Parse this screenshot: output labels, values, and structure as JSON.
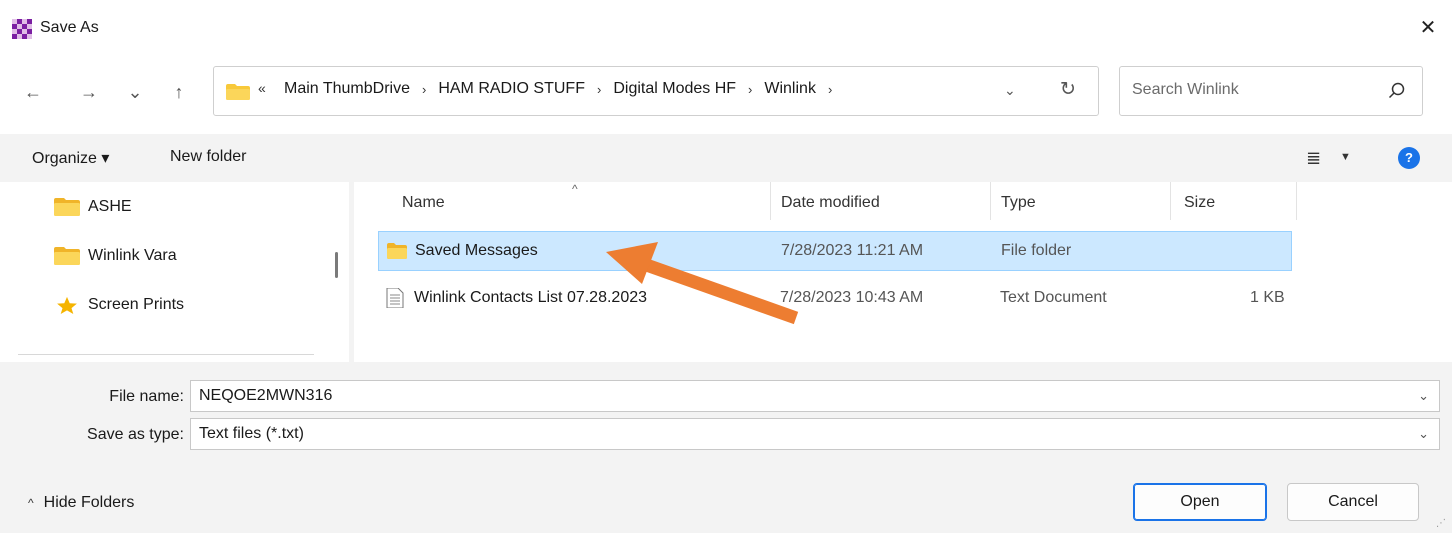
{
  "window": {
    "title": "Save As",
    "app_icon": "app-checker-icon",
    "close_icon": "close-icon",
    "close_glyph": "✕"
  },
  "nav": {
    "back_icon": "arrow-left-icon",
    "forward_icon": "arrow-right-icon",
    "recent_icon": "chevron-down-icon",
    "up_icon": "arrow-up-icon",
    "back_glyph": "←",
    "forward_glyph": "→",
    "recent_glyph": "⌄",
    "up_glyph": "↑",
    "address": {
      "overflow_chevron": "«",
      "crumbs": [
        "Main ThumbDrive",
        "HAM RADIO STUFF",
        "Digital Modes HF",
        "Winlink"
      ],
      "separator": "›",
      "dropdown_glyph": "⌄",
      "refresh_glyph": "↻"
    },
    "search": {
      "placeholder": "Search Winlink"
    }
  },
  "toolbar": {
    "organize_label": "Organize ▾",
    "new_folder_label": "New folder",
    "view_glyph": "≣",
    "view_dd_glyph": "▼",
    "help_glyph": "?"
  },
  "sidebar": {
    "items": [
      {
        "label": "ASHE",
        "icon": "folder-icon"
      },
      {
        "label": "Winlink Vara",
        "icon": "folder-icon"
      },
      {
        "label": "Screen Prints",
        "icon": "star-icon"
      }
    ]
  },
  "filelist": {
    "sort_caret": "^",
    "columns": [
      "Name",
      "Date modified",
      "Type",
      "Size"
    ],
    "rows": [
      {
        "name": "Saved Messages",
        "date": "7/28/2023 11:21 AM",
        "type": "File folder",
        "size": "",
        "icon": "folder-icon",
        "selected": true
      },
      {
        "name": "Winlink Contacts List 07.28.2023",
        "date": "7/28/2023 10:43 AM",
        "type": "Text Document",
        "size": "1 KB",
        "icon": "text-document-icon",
        "selected": false
      }
    ]
  },
  "annotation": {
    "arrow_color": "#ed7d31"
  },
  "form": {
    "file_name_label": "File name:",
    "file_name_value": "NEQOE2MWN316",
    "save_type_label": "Save as type:",
    "save_type_value": "Text files (*.txt)",
    "dropdown_glyph": "⌄"
  },
  "footer": {
    "hide_folders_label": "Hide Folders",
    "hide_glyph": "^",
    "open_label": "Open",
    "cancel_label": "Cancel"
  },
  "colors": {
    "accent": "#1a73e8",
    "selection_bg": "#cce8ff",
    "folder_yellow": "#f8c93a"
  }
}
